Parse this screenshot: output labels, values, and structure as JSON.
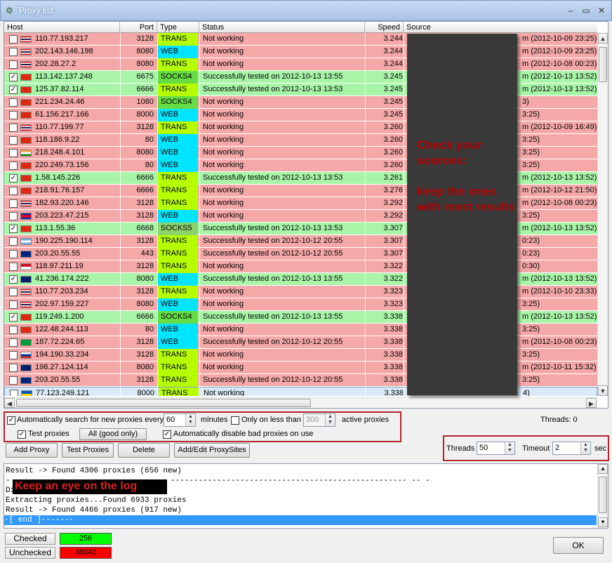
{
  "window": {
    "title": "Proxy list",
    "minimize": "–",
    "maximize": "▭",
    "close": "✕"
  },
  "colors": {
    "bad_row": "#f5a8a8",
    "good_row": "#a8f5a8",
    "trans": "#b6ff00",
    "web": "#00e5ff",
    "socks4": "#66dd44",
    "socks5": "#8bd36a",
    "annotation": "#b3262e",
    "checked_bar": "#00ff00",
    "unchecked_bar": "#ff0000"
  },
  "columns": {
    "host": "Host",
    "port": "Port",
    "type": "Type",
    "status": "Status",
    "speed": "Speed",
    "source": "Source"
  },
  "rows": [
    {
      "checked": false,
      "flag": "th",
      "host": "110.77.193.217",
      "port": "3128",
      "type": "TRANS",
      "status": "Not working",
      "speed": "3.244",
      "source": "m (2012-10-09 23:25)",
      "state": "bad"
    },
    {
      "checked": false,
      "flag": "th",
      "host": "202.143.146.198",
      "port": "8080",
      "type": "WEB",
      "status": "Not working",
      "speed": "3.244",
      "source": "m (2012-10-09 23:25)",
      "state": "bad"
    },
    {
      "checked": false,
      "flag": "th",
      "host": "202.28.27.2",
      "port": "8080",
      "type": "TRANS",
      "status": "Not working",
      "speed": "3.244",
      "source": "m (2012-10-08 00:23)",
      "state": "bad"
    },
    {
      "checked": true,
      "flag": "cn",
      "host": "113.142.137.248",
      "port": "6675",
      "type": "SOCKS4",
      "status": "Successfully tested on 2012-10-13 13:55",
      "speed": "3.245",
      "source": "m (2012-10-13 13:52)",
      "state": "good"
    },
    {
      "checked": true,
      "flag": "cn",
      "host": "125.37.82.114",
      "port": "6666",
      "type": "TRANS",
      "status": "Successfully tested on 2012-10-13 13:53",
      "speed": "3.245",
      "source": "m (2012-10-13 13:52)",
      "state": "good"
    },
    {
      "checked": false,
      "flag": "cn",
      "host": "221.234.24.46",
      "port": "1080",
      "type": "SOCKS4",
      "status": "Not working",
      "speed": "3.245",
      "source": "3)",
      "state": "bad"
    },
    {
      "checked": false,
      "flag": "cn",
      "host": "61.156.217.166",
      "port": "8000",
      "type": "WEB",
      "status": "Not working",
      "speed": "3.245",
      "source": "3:25)",
      "state": "bad"
    },
    {
      "checked": false,
      "flag": "th",
      "host": "110.77.199.77",
      "port": "3128",
      "type": "TRANS",
      "status": "Not working",
      "speed": "3.260",
      "source": "m (2012-10-09 16:49)",
      "state": "bad"
    },
    {
      "checked": false,
      "flag": "cn",
      "host": "118.186.9.22",
      "port": "80",
      "type": "WEB",
      "status": "Not working",
      "speed": "3.260",
      "source": "3:25)",
      "state": "bad"
    },
    {
      "checked": false,
      "flag": "in",
      "host": "218.248.4.101",
      "port": "8080",
      "type": "WEB",
      "status": "Not working",
      "speed": "3.260",
      "source": "3:25)",
      "state": "bad"
    },
    {
      "checked": false,
      "flag": "cn",
      "host": "220.249.73.156",
      "port": "80",
      "type": "WEB",
      "status": "Not working",
      "speed": "3.260",
      "source": "3:25)",
      "state": "bad"
    },
    {
      "checked": true,
      "flag": "cn",
      "host": "1.58.145.226",
      "port": "6666",
      "type": "TRANS",
      "status": "Successfully tested on 2012-10-13 13:53",
      "speed": "3.261",
      "source": "m (2012-10-13 13:52)",
      "state": "good"
    },
    {
      "checked": false,
      "flag": "cn",
      "host": "218.91.76.157",
      "port": "6666",
      "type": "TRANS",
      "status": "Not working",
      "speed": "3.276",
      "source": "m (2012-10-12 21:50)",
      "state": "bad"
    },
    {
      "checked": false,
      "flag": "th",
      "host": "182.93.220.146",
      "port": "3128",
      "type": "TRANS",
      "status": "Not working",
      "speed": "3.292",
      "source": "m (2012-10-08 00:23)",
      "state": "bad"
    },
    {
      "checked": false,
      "flag": "kh",
      "host": "203.223.47.215",
      "port": "3128",
      "type": "WEB",
      "status": "Not working",
      "speed": "3.292",
      "source": "3:25)",
      "state": "bad"
    },
    {
      "checked": true,
      "flag": "cn",
      "host": "113.1.55.36",
      "port": "6668",
      "type": "SOCKS5",
      "status": "Successfully tested on 2012-10-13 13:53",
      "speed": "3.307",
      "source": "m (2012-10-13 13:52)",
      "state": "good"
    },
    {
      "checked": false,
      "flag": "ar",
      "host": "190.225.190.114",
      "port": "3128",
      "type": "TRANS",
      "status": "Successfully tested on 2012-10-12 20:55",
      "speed": "3.307",
      "source": "0:23)",
      "state": "bad"
    },
    {
      "checked": false,
      "flag": "au",
      "host": "203.20.55.55",
      "port": "443",
      "type": "TRANS",
      "status": "Successfully tested on 2012-10-12 20:55",
      "speed": "3.307",
      "source": "0:23)",
      "state": "bad"
    },
    {
      "checked": false,
      "flag": "id",
      "host": "118.97.211.19",
      "port": "3128",
      "type": "TRANS",
      "status": "Not working",
      "speed": "3.322",
      "source": "0:30)",
      "state": "bad"
    },
    {
      "checked": true,
      "flag": "gb",
      "host": "41.236.174.222",
      "port": "8080",
      "type": "WEB",
      "status": "Successfully tested on 2012-10-13 13:55",
      "speed": "3.322",
      "source": "m (2012-10-13 13:52)",
      "state": "good"
    },
    {
      "checked": false,
      "flag": "th",
      "host": "110.77.203.234",
      "port": "3128",
      "type": "TRANS",
      "status": "Not working",
      "speed": "3.323",
      "source": "m (2012-10-10 23:33)",
      "state": "bad"
    },
    {
      "checked": false,
      "flag": "th",
      "host": "202.97.159.227",
      "port": "8080",
      "type": "WEB",
      "status": "Not working",
      "speed": "3.323",
      "source": "3:25)",
      "state": "bad"
    },
    {
      "checked": true,
      "flag": "cn",
      "host": "119.249.1.200",
      "port": "6666",
      "type": "SOCKS4",
      "status": "Successfully tested on 2012-10-13 13:55",
      "speed": "3.338",
      "source": "m (2012-10-13 13:52)",
      "state": "good"
    },
    {
      "checked": false,
      "flag": "cn",
      "host": "122.48.244.113",
      "port": "80",
      "type": "WEB",
      "status": "Not working",
      "speed": "3.338",
      "source": "3:25)",
      "state": "bad"
    },
    {
      "checked": false,
      "flag": "br",
      "host": "187.72.224.65",
      "port": "3128",
      "type": "WEB",
      "status": "Successfully tested on 2012-10-12 20:55",
      "speed": "3.338",
      "source": "m (2012-10-08 00:23)",
      "state": "bad"
    },
    {
      "checked": false,
      "flag": "ru",
      "host": "194.190.33.234",
      "port": "3128",
      "type": "TRANS",
      "status": "Not working",
      "speed": "3.338",
      "source": "3:25)",
      "state": "bad"
    },
    {
      "checked": false,
      "flag": "gb",
      "host": "198.27.124.114",
      "port": "8080",
      "type": "TRANS",
      "status": "Not working",
      "speed": "3.338",
      "source": "m (2012-10-11 15:32)",
      "state": "bad"
    },
    {
      "checked": false,
      "flag": "au",
      "host": "203.20.55.55",
      "port": "3128",
      "type": "TRANS",
      "status": "Successfully tested on 2012-10-12 20:55",
      "speed": "3.338",
      "source": "3:25)",
      "state": "bad"
    },
    {
      "checked": false,
      "flag": "ua",
      "host": "77.123.249.121",
      "port": "8000",
      "type": "TRANS",
      "status": "Not working",
      "speed": "3.338",
      "source": "4)",
      "state": "sel"
    }
  ],
  "overlay_note": "Check your sources:\n\nkeep the ones with most results",
  "options": {
    "auto_search_label": "Automatically search for new proxies every",
    "auto_search_checked": true,
    "interval_value": "60",
    "minutes_label": "minutes",
    "only_less_label": "Only on less than",
    "only_less_checked": false,
    "active_value": "300",
    "active_label": "active proxies",
    "test_proxies_label": "Test proxies",
    "test_proxies_checked": true,
    "filter_value": "All (good only)",
    "auto_disable_label": "Automatically disable bad proxies on use",
    "auto_disable_checked": true
  },
  "threads_status": "Threads: 0",
  "buttons": {
    "add_proxy": "Add Proxy",
    "test_proxies": "Test Proxies",
    "delete": "Delete",
    "add_edit_sites": "Add/Edit ProxySites",
    "ok": "OK"
  },
  "threads": {
    "threads_label": "Threads",
    "threads_value": "50",
    "timeout_label": "Timeout",
    "timeout_value": "2",
    "sec_label": "sec"
  },
  "log": {
    "lines": [
      "Result -> Found 4306 proxies (656 new)",
      "-",
      "--------------------------------------------------- -- -",
      "Di",
      "Extracting proxies...Found 6933 proxies",
      "Result -> Found 4466 proxies (917 new)",
      "-[ end ]-------"
    ],
    "note": "Keep an eye on the log"
  },
  "stats": {
    "checked_label": "Checked",
    "checked_value": "256",
    "unchecked_label": "Unchecked",
    "unchecked_value": "38043"
  }
}
